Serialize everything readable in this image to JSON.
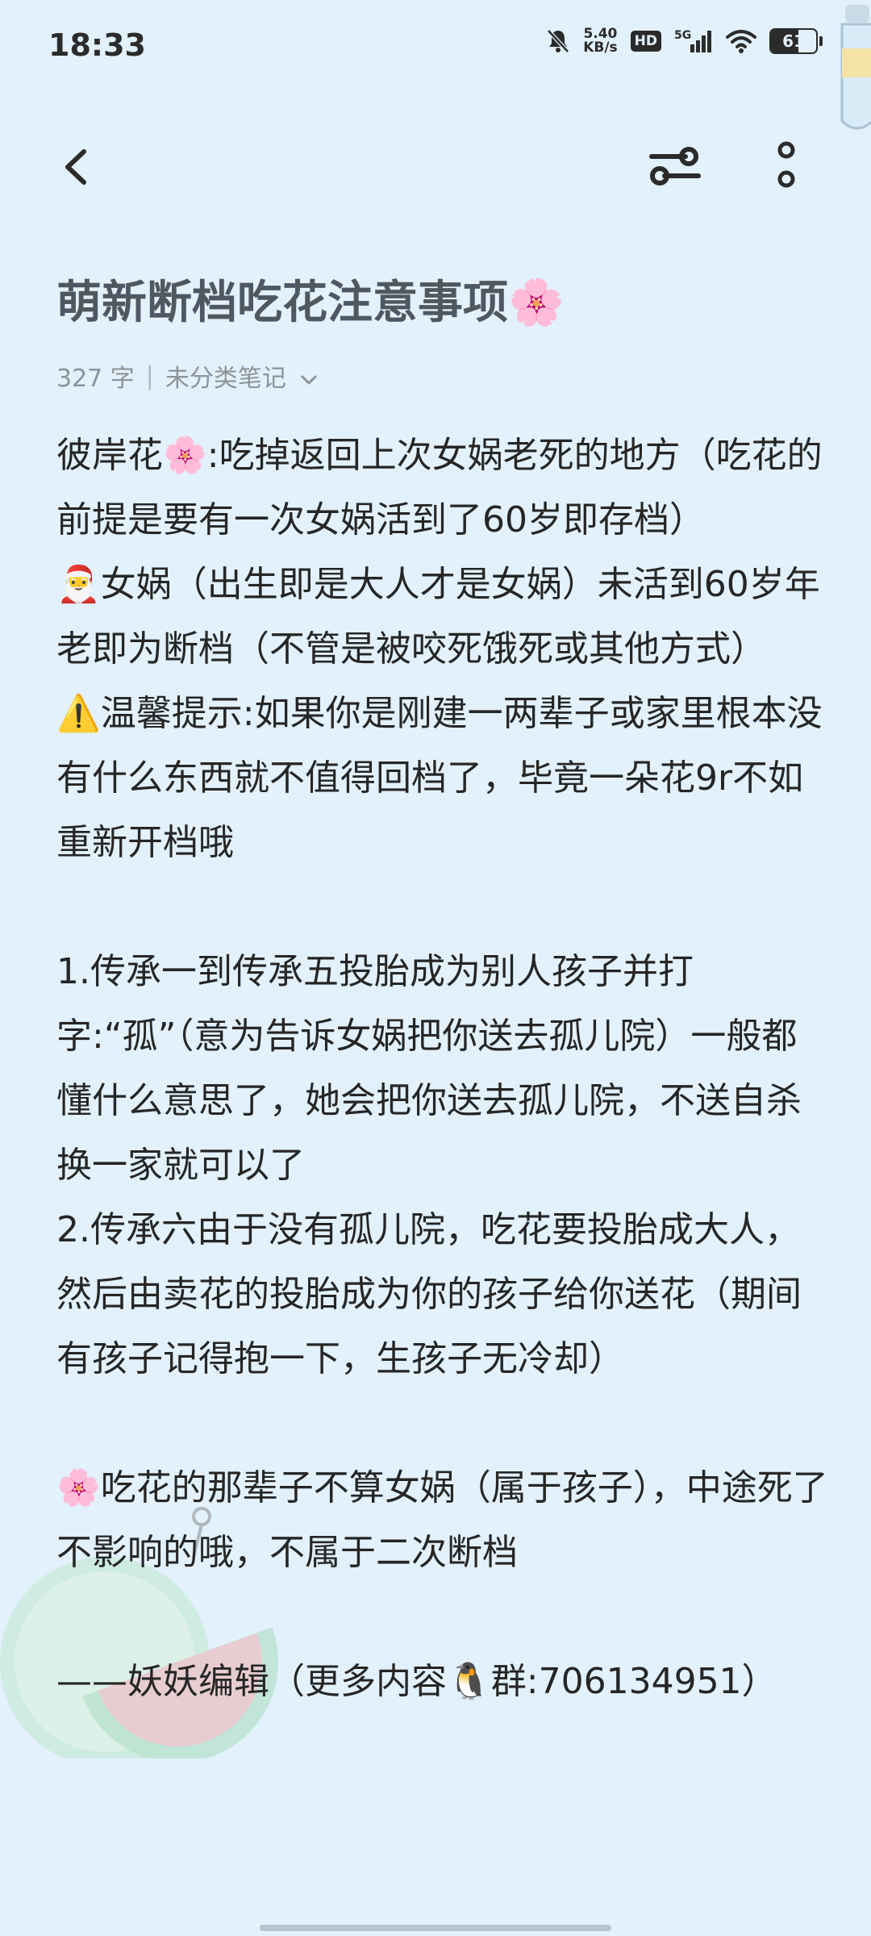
{
  "status_bar": {
    "time": "18:33",
    "net_speed_value": "5.40",
    "net_speed_unit": "KB/s",
    "hd_label": "HD",
    "signal_label": "5G",
    "battery_level": "61",
    "battery_fraction": 0.61
  },
  "toolbar": {
    "back_icon": "chevron-left-icon",
    "adjust_icon": "sliders-icon",
    "more_icon": "more-vertical-icon"
  },
  "note": {
    "title": "萌新断档吃花注意事项🌸",
    "word_count": "327 字",
    "category": "未分类笔记",
    "paragraphs": [
      "彼岸花🌸:吃掉返回上次女娲老死的地方（吃花的前提是要有一次女娲活到了60岁即存档）",
      "🎅女娲（出生即是大人才是女娲）未活到60岁年老即为断档（不管是被咬死饿死或其他方式）",
      "⚠️温馨提示:如果你是刚建一两辈子或家里根本没有什么东西就不值得回档了，毕竟一朵花9r不如重新开档哦",
      "",
      "1.传承一到传承五投胎成为别人孩子并打字:“孤”（意为告诉女娲把你送去孤儿院）一般都懂什么意思了，她会把你送去孤儿院，不送自杀换一家就可以了",
      "2.传承六由于没有孤儿院，吃花要投胎成大人，然后由卖花的投胎成为你的孩子给你送花（期间有孩子记得抱一下，生孩子无冷却）",
      "",
      "🌸吃花的那辈子不算女娲（属于孩子），中途死了不影响的哦，不属于二次断档",
      "",
      "——妖妖编辑（更多内容🐧群:706134951）"
    ]
  }
}
